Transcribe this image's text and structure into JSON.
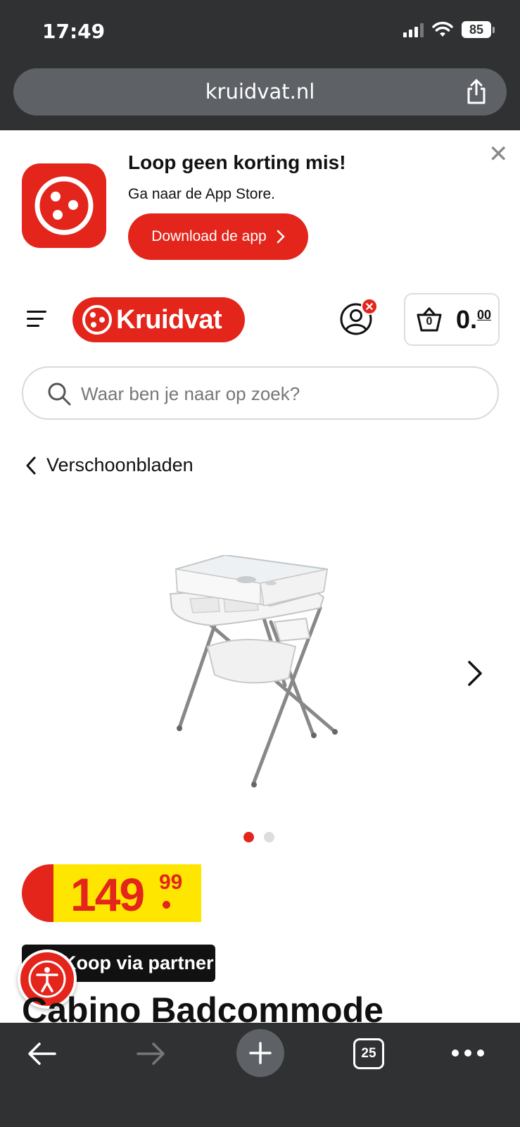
{
  "status_bar": {
    "time": "17:49",
    "battery": "85"
  },
  "browser": {
    "url": "kruidvat.nl",
    "tab_count": "25"
  },
  "app_banner": {
    "title": "Loop geen korting mis!",
    "subtitle": "Ga naar de App Store.",
    "button_label": "Download de app"
  },
  "header": {
    "logo_text": "Kruidvat",
    "account_badge": "✕",
    "cart_count": "0",
    "cart_total_whole": "0.",
    "cart_total_cents": "00"
  },
  "search": {
    "placeholder": "Waar ben je naar op zoek?"
  },
  "breadcrumb": {
    "back_label": "Verschoonbladen"
  },
  "carousel": {
    "slide_count": 2,
    "active_index": 0
  },
  "product": {
    "price_whole": "149",
    "price_cents": "99",
    "partner_label": "Koop via partner",
    "title": "Cabino Badcommode"
  },
  "colors": {
    "brand_red": "#e3251b",
    "price_yellow": "#ffe600",
    "chrome_dark": "#2f3133"
  }
}
